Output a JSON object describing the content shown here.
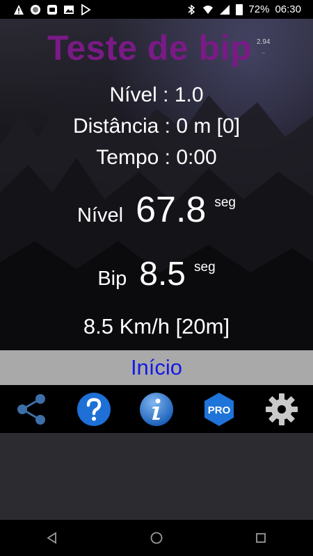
{
  "status_bar": {
    "battery": "72%",
    "time": "06:30",
    "left_icons": [
      "warning-icon",
      "circle-icon",
      "en-keyboard-icon",
      "image-icon",
      "play-store-icon"
    ],
    "right_icons": [
      "bluetooth-icon",
      "wifi-icon",
      "signal-icon",
      "battery-icon"
    ]
  },
  "header": {
    "title": "Teste de bip",
    "version": "2.94",
    "version_dots": ".."
  },
  "info": {
    "level_line": "Nível : 1.0",
    "distance_line": "Distância : 0 m [0]",
    "time_line": "Tempo : 0:00"
  },
  "level_timer": {
    "label": "Nível",
    "value": "67.8",
    "unit": "seg"
  },
  "bip_timer": {
    "label": "Bip",
    "value": "8.5",
    "unit": "seg"
  },
  "speed": "8.5 Km/h [20m]",
  "start_button": "Início",
  "toolbar_icons": [
    "share-icon",
    "help-icon",
    "info-icon",
    "pro-icon",
    "settings-icon"
  ],
  "pro_label": "PRO",
  "colors": {
    "title": "#7a1a86",
    "start_bg": "#a9a9a9",
    "start_text": "#1418e6",
    "help_blue": "#1e6fd6"
  }
}
